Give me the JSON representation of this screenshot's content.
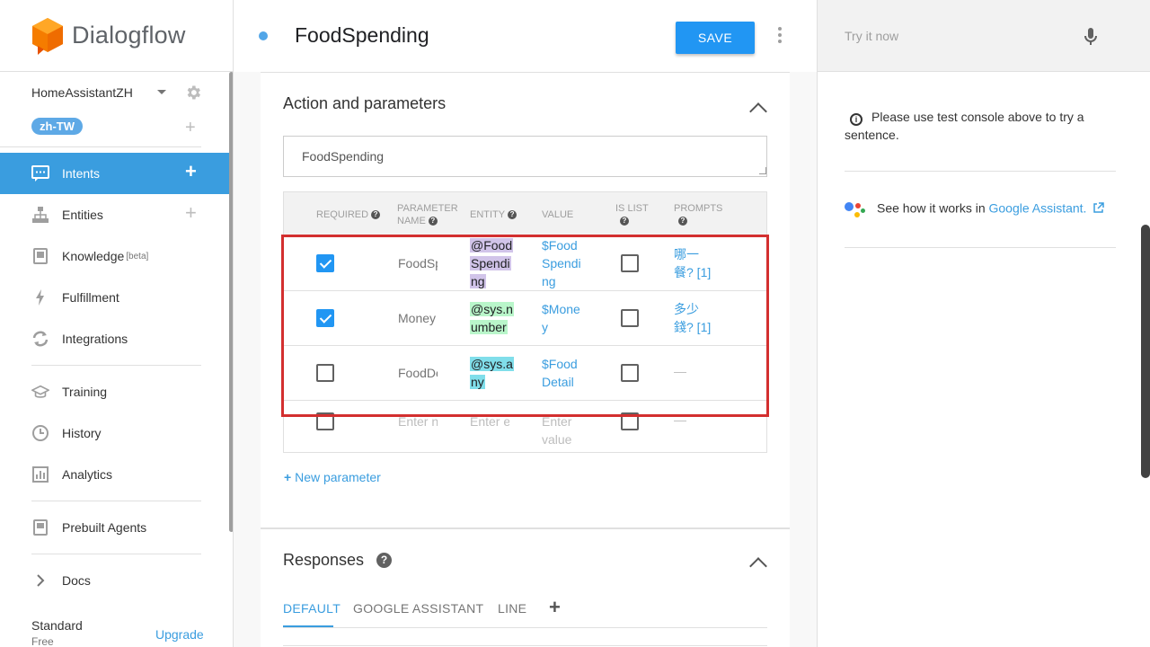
{
  "brand": {
    "name": "Dialogflow"
  },
  "agent": {
    "name": "HomeAssistantZH",
    "language": "zh-TW"
  },
  "nav": {
    "items": [
      {
        "label": "Intents"
      },
      {
        "label": "Entities"
      },
      {
        "label": "Knowledge",
        "badge": "[beta]"
      },
      {
        "label": "Fulfillment"
      },
      {
        "label": "Integrations"
      },
      {
        "label": "Training"
      },
      {
        "label": "History"
      },
      {
        "label": "Analytics"
      },
      {
        "label": "Prebuilt Agents"
      },
      {
        "label": "Docs"
      }
    ],
    "plan": "Standard",
    "plan_sub": "Free",
    "upgrade": "Upgrade"
  },
  "header": {
    "title": "FoodSpending",
    "save_label": "SAVE"
  },
  "action_params": {
    "title": "Action and parameters",
    "action_value": "FoodSpending",
    "headers": {
      "required": "REQUIRED",
      "param_name_1": "PARAMETER",
      "param_name_2": "NAME",
      "entity": "ENTITY",
      "value": "VALUE",
      "is_list": "IS LIST",
      "prompts": "PROMPTS"
    },
    "rows": [
      {
        "required": true,
        "name": "FoodSpending",
        "entity": [
          "@Food",
          "Spendi",
          "ng"
        ],
        "value": [
          "$Food",
          "Spendi",
          "ng"
        ],
        "is_list": false,
        "prompt": [
          "哪一",
          "餐? [1]"
        ]
      },
      {
        "required": true,
        "name": "Money",
        "entity": [
          "@sys.n",
          "umber"
        ],
        "value": [
          "$Mone",
          "y"
        ],
        "is_list": false,
        "prompt": [
          "多少",
          "錢? [1]"
        ]
      },
      {
        "required": false,
        "name": "FoodDetail",
        "entity": [
          "@sys.a",
          "ny"
        ],
        "value": [
          "$Food",
          "Detail"
        ],
        "is_list": false,
        "prompt": [
          "—"
        ]
      }
    ],
    "empty_row": {
      "name_placeholder": "Enter n",
      "entity_placeholder": "Enter e",
      "value_placeholder": "Enter value",
      "prompt": "—"
    },
    "new_parameter": "New parameter",
    "colors": {
      "entity_custom": "#d1c4e9",
      "entity_number": "#b9f6ca",
      "entity_any": "#80deea",
      "highlight": "#d32f2f"
    }
  },
  "responses": {
    "title": "Responses",
    "tabs": [
      "DEFAULT",
      "GOOGLE ASSISTANT",
      "LINE"
    ]
  },
  "console": {
    "placeholder": "Try it now",
    "info": "Please use test console above to try a sentence.",
    "ga_text": "See how it works in ",
    "ga_link": "Google Assistant."
  }
}
